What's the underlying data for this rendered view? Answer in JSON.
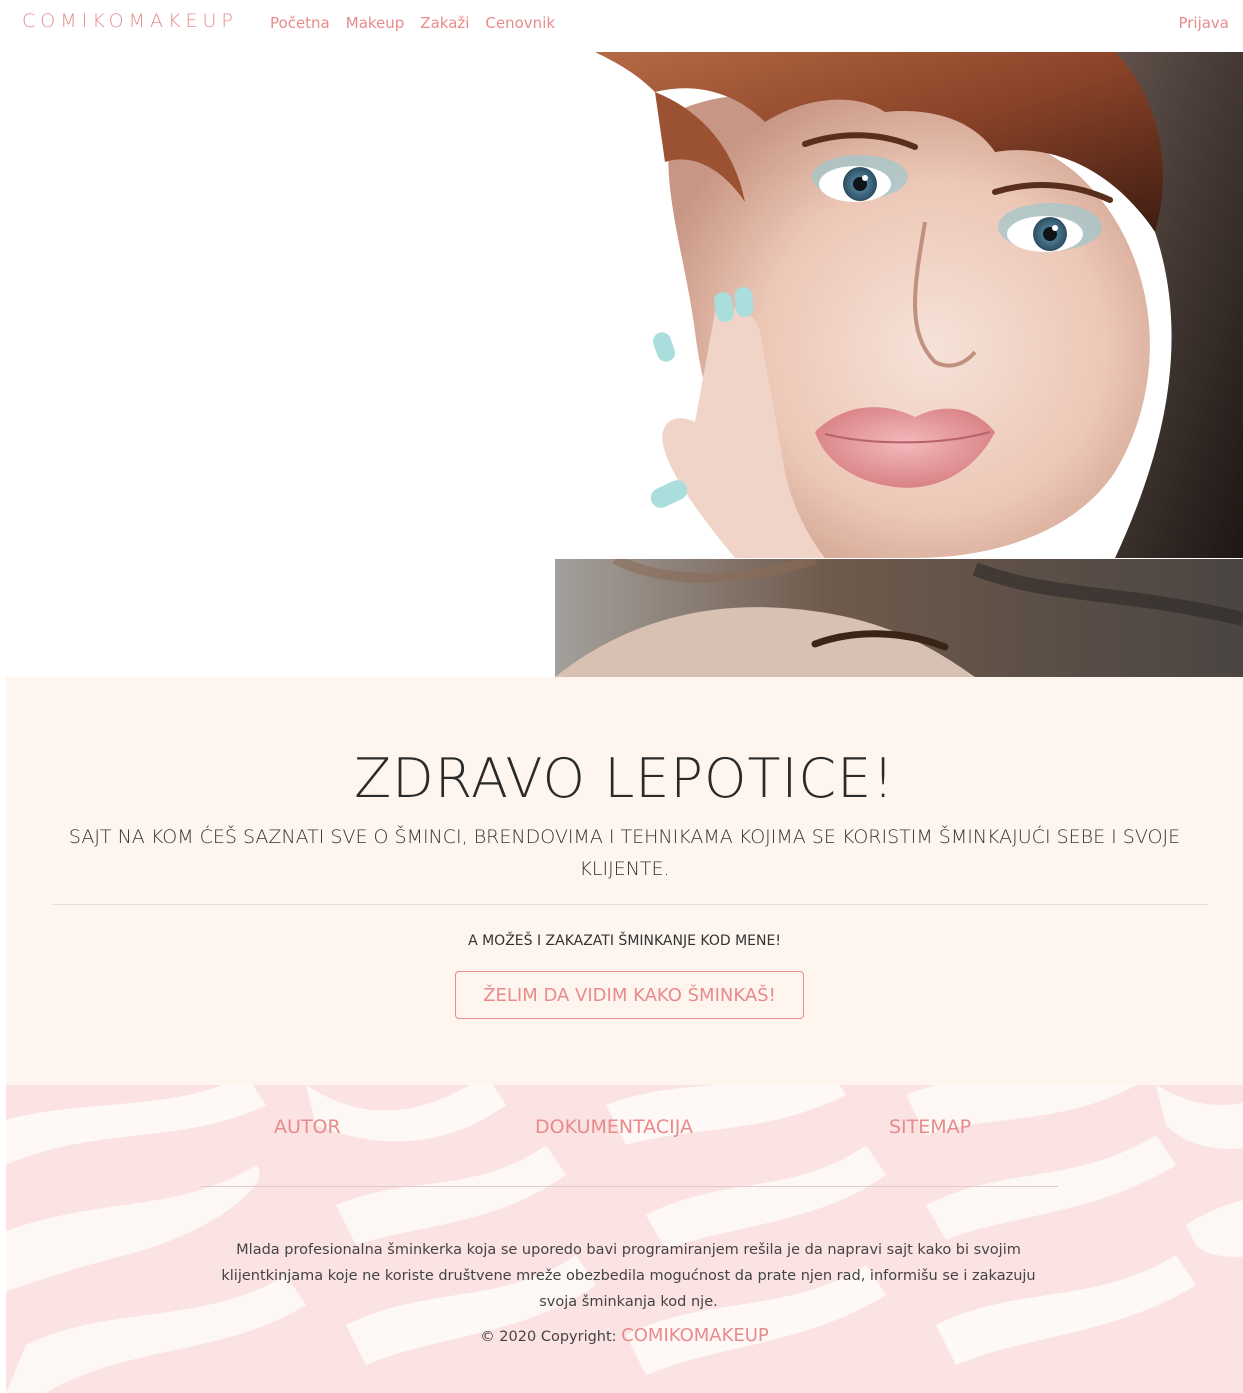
{
  "navbar": {
    "brand": "COMIKOMAKEUP",
    "links": [
      "Početna",
      "Makeup",
      "Zakaži",
      "Cenovnik"
    ],
    "login": "Prijava"
  },
  "welcome": {
    "title": "ZDRAVO LEPOTICE!",
    "subtitle": "SAJT NA KOM ĆEŠ SAZNATI SVE O ŠMINCI, BRENDOVIMA I TEHNIKAMA KOJIMA SE KORISTIM ŠMINKAJUĆI SEBE I SVOJE KLIJENTE.",
    "small": "A MOŽEŠ I ZAKAZATI ŠMINKANJE KOD MENE!",
    "cta": "ŽELIM DA VIDIM KAKO ŠMINKAŠ!"
  },
  "footer": {
    "links": [
      "AUTOR",
      "DOKUMENTACIJA",
      "SITEMAP"
    ],
    "description": "Mlada profesionalna šminkerka koja se uporedo bavi programiranjem rešila je da napravi sajt kako bi svojim klijentkinjama koje ne koriste društvene mreže obezbedila mogućnost da prate njen rad, informišu se i zakazuju svoja šminkanja kod nje.",
    "copyright_prefix": "© 2020 Copyright:",
    "copyright_brand": "COMIKOMAKEUP"
  },
  "colors": {
    "accent": "#e88b8b",
    "welcome_bg": "#fdf5ee",
    "footer_bg": "#fbe8e8"
  }
}
